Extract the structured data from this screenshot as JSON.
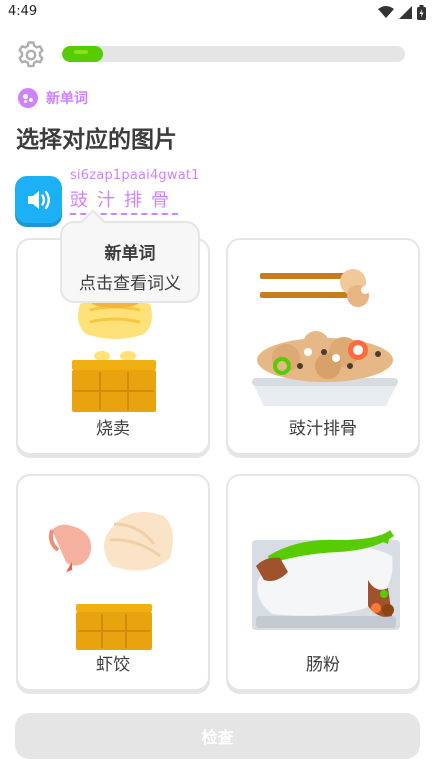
{
  "status_bar": {
    "time": "4:49"
  },
  "progress": {
    "fraction": 0.12,
    "color": "#58cc02"
  },
  "badge": {
    "label": "新单词",
    "color": "#ce82ff"
  },
  "prompt": {
    "title": "选择对应的图片"
  },
  "audio": {
    "icon": "speaker-icon",
    "color": "#1cb0f6"
  },
  "word": {
    "romanization": "si6zap1paai4gwat1",
    "hanzi": "豉汁排骨"
  },
  "tooltip": {
    "title": "新单词",
    "body": "点击查看词义"
  },
  "choices": [
    {
      "label": "烧卖",
      "icon": "siu-mai-icon"
    },
    {
      "label": "豉汁排骨",
      "icon": "black-bean-spare-ribs-icon"
    },
    {
      "label": "虾饺",
      "icon": "har-gow-icon"
    },
    {
      "label": "肠粉",
      "icon": "rice-noodle-roll-icon"
    }
  ],
  "check_button": {
    "label": "检查"
  }
}
